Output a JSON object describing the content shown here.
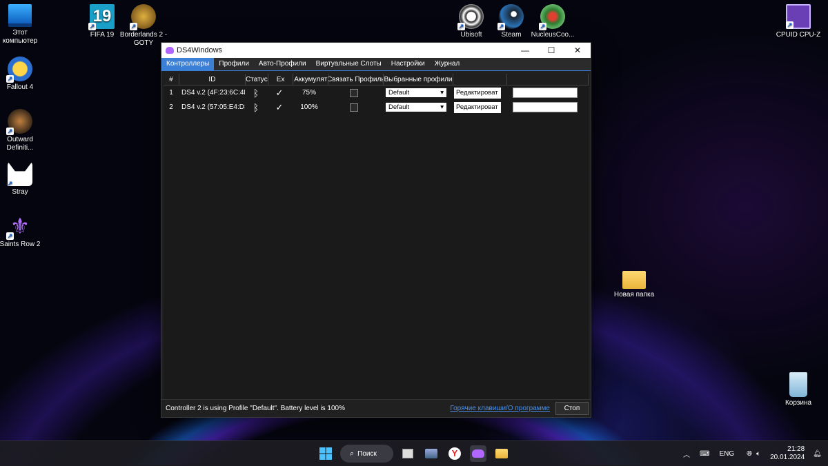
{
  "desktop": {
    "icons": [
      {
        "label": "Этот компьютер",
        "icon": "monitor-icon",
        "color": "#1e8fe0"
      },
      {
        "label": "FIFA 19",
        "icon": "fifa-icon",
        "color": "#1aa0c8",
        "badge": "19"
      },
      {
        "label": "Borderlands 2 - GOTY",
        "icon": "borderlands-icon",
        "color": "#c8a030"
      },
      {
        "label": "Ubisoft",
        "icon": "ubisoft-icon",
        "color": "#e8e8e8"
      },
      {
        "label": "Steam",
        "icon": "steam-icon",
        "color": "#1b2838"
      },
      {
        "label": "NucleusCoo...",
        "icon": "nucleus-icon",
        "color": "#2e7d32"
      },
      {
        "label": "CPUID CPU-Z",
        "icon": "cpuz-icon",
        "color": "#6a3fb5"
      },
      {
        "label": "Fallout 4",
        "icon": "fallout-icon",
        "color": "#f0c030"
      },
      {
        "label": "Outward Definiti...",
        "icon": "outward-icon",
        "color": "#6a4a2a"
      },
      {
        "label": "Stray",
        "icon": "stray-icon",
        "color": "#ffffff"
      },
      {
        "label": "Saints Row 2",
        "icon": "saints-row-icon",
        "color": "#7a3fc0"
      },
      {
        "label": "Новая папка",
        "icon": "folder-icon",
        "color": "#f4c64e"
      },
      {
        "label": "Корзина",
        "icon": "recycle-bin-icon",
        "color": "#9ad0f0"
      }
    ]
  },
  "window": {
    "title": "DS4Windows",
    "controls": {
      "minimize": "—",
      "maximize": "☐",
      "close": "✕"
    },
    "tabs": [
      "Контроллеры",
      "Профили",
      "Авто-Профили",
      "Виртуальные Слоты",
      "Настройки",
      "Журнал"
    ],
    "active_tab": 0,
    "grid": {
      "headers": [
        "#",
        "ID",
        "Статус",
        "Ex",
        "Аккумулят",
        "Связать Профиль",
        "Выбранные профили",
        "",
        ""
      ],
      "rows": [
        {
          "num": "1",
          "id": "DS4 v.2 (4F:23:6C:4F:",
          "status_icon": "bluetooth-icon",
          "ex_icon": "check-icon",
          "battery": "75%",
          "link_profile": false,
          "profile": "Default",
          "edit": "Редактироват"
        },
        {
          "num": "2",
          "id": "DS4 v.2 (57:05:E4:D3",
          "status_icon": "bluetooth-icon",
          "ex_icon": "check-icon",
          "battery": "100%",
          "link_profile": false,
          "profile": "Default",
          "edit": "Редактироват"
        }
      ]
    },
    "status_text": "Controller 2 is using Profile \"Default\". Battery level is 100%",
    "hotkeys_link": "Горячие клавиши/О программе",
    "stop_button": "Стоп",
    "accent": "#3c7fd6"
  },
  "taskbar": {
    "search_label": "Поиск",
    "language": "ENG",
    "time": "21:28",
    "date": "20.01.2024"
  }
}
